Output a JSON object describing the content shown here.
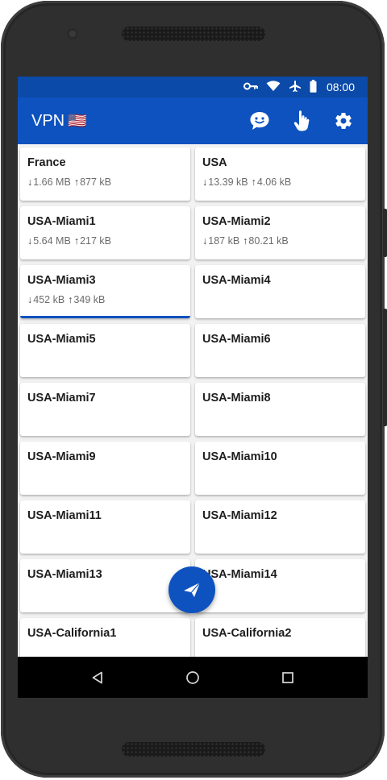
{
  "status": {
    "time": "08:00"
  },
  "header": {
    "title": "VPN",
    "flag": "🇺🇸"
  },
  "servers": [
    {
      "name": "France",
      "down": "1.66 MB",
      "up": "877 kB"
    },
    {
      "name": "USA",
      "down": "13.39 kB",
      "up": "4.06 kB"
    },
    {
      "name": "USA-Miami1",
      "down": "5.64 MB",
      "up": "217 kB"
    },
    {
      "name": "USA-Miami2",
      "down": "187 kB",
      "up": "80.21 kB"
    },
    {
      "name": "USA-Miami3",
      "down": "452 kB",
      "up": "349 kB",
      "selected": true
    },
    {
      "name": "USA-Miami4"
    },
    {
      "name": "USA-Miami5"
    },
    {
      "name": "USA-Miami6"
    },
    {
      "name": "USA-Miami7"
    },
    {
      "name": "USA-Miami8"
    },
    {
      "name": "USA-Miami9"
    },
    {
      "name": "USA-Miami10"
    },
    {
      "name": "USA-Miami11"
    },
    {
      "name": "USA-Miami12"
    },
    {
      "name": "USA-Miami13"
    },
    {
      "name": "USA-Miami14"
    },
    {
      "name": "USA-California1"
    },
    {
      "name": "USA-California2"
    }
  ],
  "colors": {
    "accent": "#0d52bf",
    "statusbar": "#0b4aa8",
    "navbar": "#000000"
  },
  "icons": {
    "status": [
      "key-icon",
      "wifi-icon",
      "airplane-icon",
      "battery-icon"
    ],
    "toolbar": [
      "chat-icon",
      "touch-icon",
      "settings-icon"
    ],
    "fab": "send-icon",
    "nav": [
      "back-icon",
      "home-icon",
      "recents-icon"
    ]
  }
}
